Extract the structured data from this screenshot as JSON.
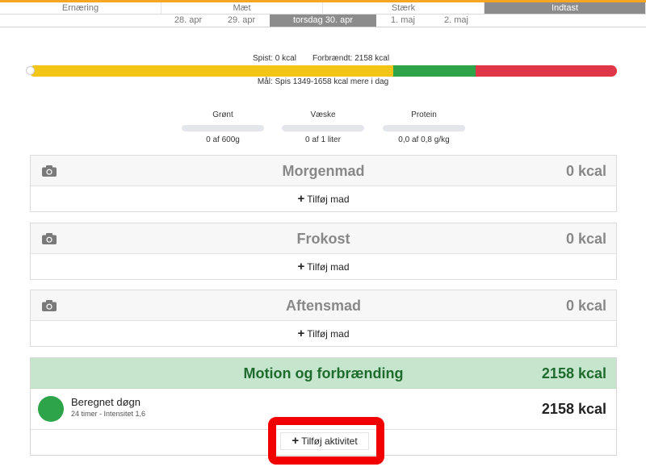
{
  "tabs": [
    {
      "label": "Ernæring",
      "active": false
    },
    {
      "label": "Mæt",
      "active": false
    },
    {
      "label": "Stærk",
      "active": false
    },
    {
      "label": "Indtast",
      "active": true
    }
  ],
  "dates": [
    {
      "label": "28. apr",
      "active": false
    },
    {
      "label": "29. apr",
      "active": false
    },
    {
      "label": "torsdag 30. apr",
      "active": true
    },
    {
      "label": "1. maj",
      "active": false
    },
    {
      "label": "2. maj",
      "active": false
    }
  ],
  "calories": {
    "eaten": "Spist: 0 kcal",
    "burned": "Forbrændt: 2158 kcal",
    "goal": "Mål: Spis 1349-1658 kcal mere i dag",
    "bar_segments": [
      {
        "fraction": 0.62,
        "color": "#f3c516"
      },
      {
        "fraction": 0.14,
        "color": "#2ea44a"
      },
      {
        "fraction": 0.24,
        "color": "#e0364a"
      }
    ]
  },
  "macros": [
    {
      "label": "Grønt",
      "value": "0 af 600g",
      "progress": 0
    },
    {
      "label": "Væske",
      "value": "0 af 1 liter",
      "progress": 0
    },
    {
      "label": "Protein",
      "value": "0,0 af 0,8 g/kg",
      "progress": 0
    }
  ],
  "meals": [
    {
      "title": "Morgenmad",
      "kcal": "0 kcal",
      "add_label": "Tilføj mad",
      "icon": "camera-icon"
    },
    {
      "title": "Frokost",
      "kcal": "0 kcal",
      "add_label": "Tilføj mad",
      "icon": "camera-icon"
    },
    {
      "title": "Aftensmad",
      "kcal": "0 kcal",
      "add_label": "Tilføj mad",
      "icon": "camera-icon"
    }
  ],
  "motion": {
    "title": "Motion og forbrænding",
    "kcal": "2158 kcal",
    "activity": {
      "name": "Beregnet døgn",
      "detail": "24 timer - Intensitet 1,6",
      "kcal": "2158 kcal"
    },
    "add_label": "Tilføj aktivitet"
  },
  "colors": {
    "accent": "#f5a623",
    "active_tab": "#8c8c8c",
    "motion_header": "#c5e6cd",
    "motion_text": "#1f6b2e",
    "highlight": "#f20000"
  }
}
